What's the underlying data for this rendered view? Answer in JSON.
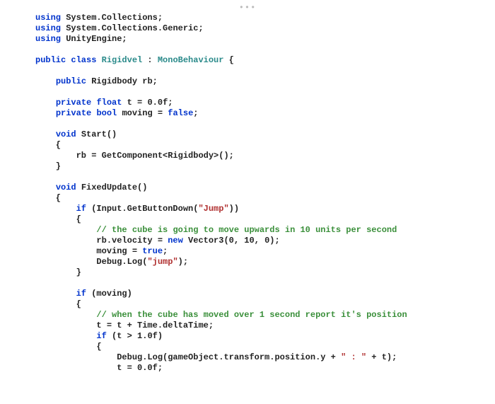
{
  "dots": "•••",
  "code": {
    "l01a": "using",
    "l01b": " System.Collections;",
    "l02a": "using",
    "l02b": " System.Collections.Generic;",
    "l03a": "using",
    "l03b": " UnityEngine;",
    "l04": "",
    "l05a": "public class ",
    "l05b": "Rigidvel",
    "l05c": " : ",
    "l05d": "MonoBehaviour",
    "l05e": " {",
    "l06": "",
    "l07a": "    ",
    "l07b": "public",
    "l07c": " Rigidbody rb;",
    "l08": "",
    "l09a": "    ",
    "l09b": "private",
    "l09c": " ",
    "l09d": "float",
    "l09e": " t = 0.0f;",
    "l10a": "    ",
    "l10b": "private",
    "l10c": " ",
    "l10d": "bool",
    "l10e": " moving = ",
    "l10f": "false",
    "l10g": ";",
    "l11": "",
    "l12a": "    ",
    "l12b": "void",
    "l12c": " Start()",
    "l13": "    {",
    "l14a": "        rb = GetComponent<Rigidbody>();",
    "l15": "    }",
    "l16": "",
    "l17a": "    ",
    "l17b": "void",
    "l17c": " FixedUpdate()",
    "l18": "    {",
    "l19a": "        ",
    "l19b": "if",
    "l19c": " (Input.GetButtonDown(",
    "l19d": "\"Jump\"",
    "l19e": "))",
    "l20": "        {",
    "l21a": "            ",
    "l21b": "// the cube is going to move upwards in 10 units per second",
    "l22a": "            rb.velocity = ",
    "l22b": "new",
    "l22c": " Vector3(0, 10, 0);",
    "l23a": "            moving = ",
    "l23b": "true",
    "l23c": ";",
    "l24a": "            Debug.Log(",
    "l24b": "\"jump\"",
    "l24c": ");",
    "l25": "        }",
    "l26": "",
    "l27a": "        ",
    "l27b": "if",
    "l27c": " (moving)",
    "l28": "        {",
    "l29a": "            ",
    "l29b": "// when the cube has moved over 1 second report it's position",
    "l30": "            t = t + Time.deltaTime;",
    "l31a": "            ",
    "l31b": "if",
    "l31c": " (t > 1.0f)",
    "l32": "            {",
    "l33a": "                Debug.Log(gameObject.transform.position.y + ",
    "l33b": "\" : \"",
    "l33c": " + t);",
    "l34": "                t = 0.0f;"
  }
}
